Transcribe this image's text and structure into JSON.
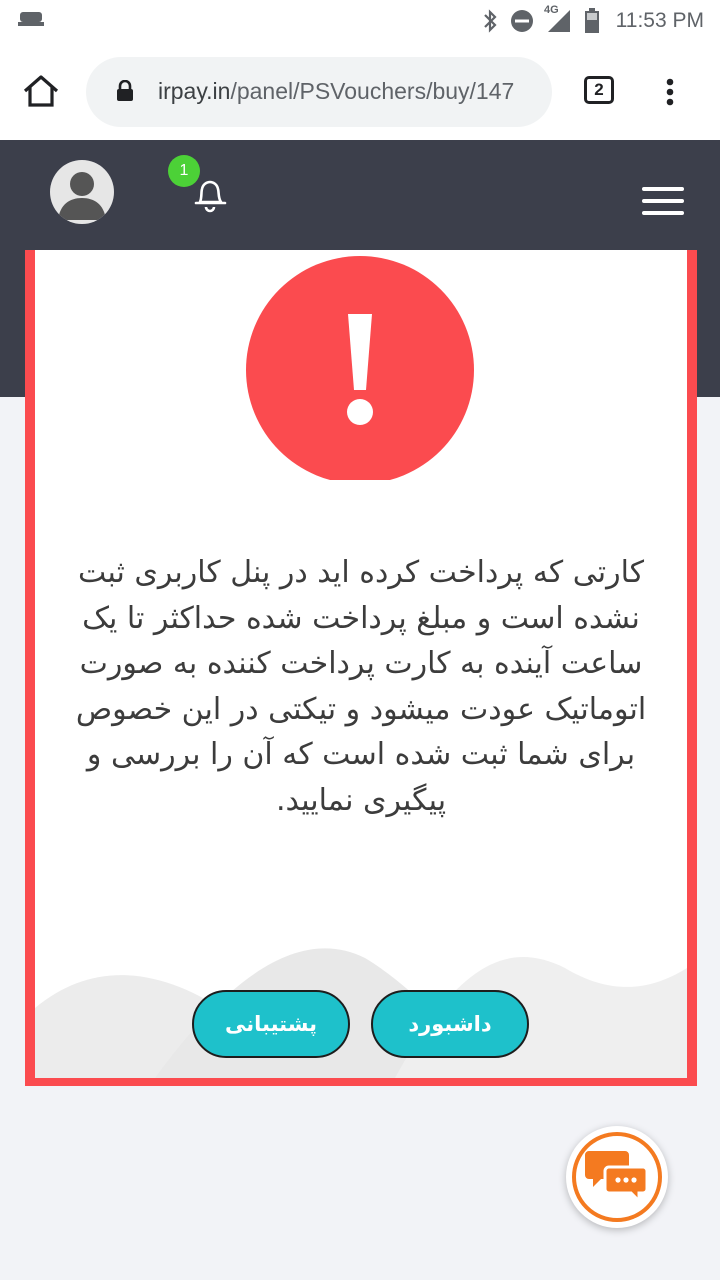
{
  "status_bar": {
    "time": "11:53 PM",
    "network_label": "4G",
    "icons": [
      "notification-icon",
      "bluetooth-icon",
      "dnd-icon",
      "signal-icon",
      "battery-icon"
    ]
  },
  "browser": {
    "url_domain": "irpay.in",
    "url_path": "/panel/PSVouchers/buy/147",
    "tab_count": "2",
    "icons": [
      "home-icon",
      "lock-icon",
      "more-vert-icon"
    ]
  },
  "header": {
    "notification_count": "1",
    "icons": [
      "avatar-icon",
      "bell-icon",
      "menu-icon"
    ]
  },
  "modal": {
    "icon": "exclamation-icon",
    "message": "کارتی که پرداخت کرده اید در پنل کاربری ثبت نشده است و مبلغ پرداخت شده حداکثر تا یک ساعت آینده به کارت پرداخت کننده به صورت اتوماتیک عودت میشود و تیکتی در این خصوص برای شما ثبت شده است که آن را بررسی و پیگیری نمایید.",
    "buttons": {
      "dashboard": "داشبورد",
      "support": "پشتیبانی"
    }
  },
  "chat": {
    "icon": "chat-icon"
  },
  "colors": {
    "header_bg": "#3c3f4b",
    "accent_red": "#fb4b4f",
    "button_teal": "#1ec1cb",
    "badge_green": "#4cd137",
    "chat_orange": "#f47a20"
  }
}
